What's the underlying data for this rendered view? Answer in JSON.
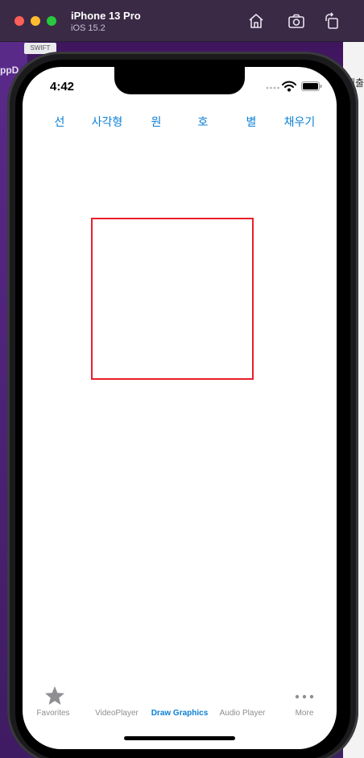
{
  "simulator": {
    "device_name": "iPhone 13 Pro",
    "os_version": "iOS 15.2"
  },
  "background": {
    "left_text": "ppD",
    "right_text": "제출",
    "tab_text": "SWIFT"
  },
  "status_bar": {
    "time": "4:42"
  },
  "toolbar": {
    "line": "선",
    "rectangle": "사각형",
    "circle": "원",
    "arc": "호",
    "star": "별",
    "fill": "채우기"
  },
  "canvas": {
    "shape": "rectangle",
    "stroke_color": "#e8202a"
  },
  "tab_bar": {
    "items": [
      {
        "label": "Favorites",
        "icon": "star-icon",
        "selected": false
      },
      {
        "label": "VideoPlayer",
        "icon": "",
        "selected": false
      },
      {
        "label": "Draw Graphics",
        "icon": "",
        "selected": true
      },
      {
        "label": "Audio Player",
        "icon": "",
        "selected": false
      },
      {
        "label": "More",
        "icon": "more-icon",
        "selected": false
      }
    ],
    "accent_color": "#0a7fd6",
    "inactive_color": "#8e8e93"
  }
}
